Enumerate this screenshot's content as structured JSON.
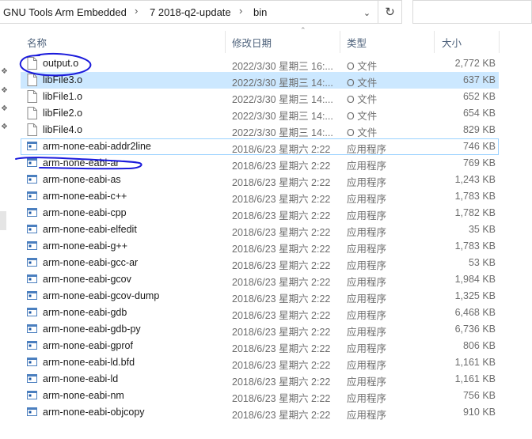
{
  "address": {
    "crumbs": [
      "GNU Tools Arm Embedded",
      "7 2018-q2-update",
      "bin"
    ]
  },
  "columns": {
    "name": "名称",
    "date": "修改日期",
    "type": "类型",
    "size": "大小"
  },
  "files": [
    {
      "name": "output.o",
      "date": "2022/3/30 星期三 16:...",
      "type": "O 文件",
      "size": "2,772 KB",
      "icon": "file-icon"
    },
    {
      "name": "libFile3.o",
      "date": "2022/3/30 星期三 14:...",
      "type": "O 文件",
      "size": "637 KB",
      "icon": "file-icon"
    },
    {
      "name": "libFile1.o",
      "date": "2022/3/30 星期三 14:...",
      "type": "O 文件",
      "size": "652 KB",
      "icon": "file-icon"
    },
    {
      "name": "libFile2.o",
      "date": "2022/3/30 星期三 14:...",
      "type": "O 文件",
      "size": "654 KB",
      "icon": "file-icon"
    },
    {
      "name": "libFile4.o",
      "date": "2022/3/30 星期三 14:...",
      "type": "O 文件",
      "size": "829 KB",
      "icon": "file-icon"
    },
    {
      "name": "arm-none-eabi-addr2line",
      "date": "2018/6/23 星期六 2:22",
      "type": "应用程序",
      "size": "746 KB",
      "icon": "exe-icon"
    },
    {
      "name": "arm-none-eabi-ar",
      "date": "2018/6/23 星期六 2:22",
      "type": "应用程序",
      "size": "769 KB",
      "icon": "exe-icon"
    },
    {
      "name": "arm-none-eabi-as",
      "date": "2018/6/23 星期六 2:22",
      "type": "应用程序",
      "size": "1,243 KB",
      "icon": "exe-icon"
    },
    {
      "name": "arm-none-eabi-c++",
      "date": "2018/6/23 星期六 2:22",
      "type": "应用程序",
      "size": "1,783 KB",
      "icon": "exe-icon"
    },
    {
      "name": "arm-none-eabi-cpp",
      "date": "2018/6/23 星期六 2:22",
      "type": "应用程序",
      "size": "1,782 KB",
      "icon": "exe-icon"
    },
    {
      "name": "arm-none-eabi-elfedit",
      "date": "2018/6/23 星期六 2:22",
      "type": "应用程序",
      "size": "35 KB",
      "icon": "exe-icon"
    },
    {
      "name": "arm-none-eabi-g++",
      "date": "2018/6/23 星期六 2:22",
      "type": "应用程序",
      "size": "1,783 KB",
      "icon": "exe-icon"
    },
    {
      "name": "arm-none-eabi-gcc-ar",
      "date": "2018/6/23 星期六 2:22",
      "type": "应用程序",
      "size": "53 KB",
      "icon": "exe-icon"
    },
    {
      "name": "arm-none-eabi-gcov",
      "date": "2018/6/23 星期六 2:22",
      "type": "应用程序",
      "size": "1,984 KB",
      "icon": "exe-icon"
    },
    {
      "name": "arm-none-eabi-gcov-dump",
      "date": "2018/6/23 星期六 2:22",
      "type": "应用程序",
      "size": "1,325 KB",
      "icon": "exe-icon"
    },
    {
      "name": "arm-none-eabi-gdb",
      "date": "2018/6/23 星期六 2:22",
      "type": "应用程序",
      "size": "6,468 KB",
      "icon": "exe-icon"
    },
    {
      "name": "arm-none-eabi-gdb-py",
      "date": "2018/6/23 星期六 2:22",
      "type": "应用程序",
      "size": "6,736 KB",
      "icon": "exe-icon"
    },
    {
      "name": "arm-none-eabi-gprof",
      "date": "2018/6/23 星期六 2:22",
      "type": "应用程序",
      "size": "806 KB",
      "icon": "exe-icon"
    },
    {
      "name": "arm-none-eabi-ld.bfd",
      "date": "2018/6/23 星期六 2:22",
      "type": "应用程序",
      "size": "1,161 KB",
      "icon": "exe-icon"
    },
    {
      "name": "arm-none-eabi-ld",
      "date": "2018/6/23 星期六 2:22",
      "type": "应用程序",
      "size": "1,161 KB",
      "icon": "exe-icon"
    },
    {
      "name": "arm-none-eabi-nm",
      "date": "2018/6/23 星期六 2:22",
      "type": "应用程序",
      "size": "756 KB",
      "icon": "exe-icon"
    },
    {
      "name": "arm-none-eabi-objcopy",
      "date": "2018/6/23 星期六 2:22",
      "type": "应用程序",
      "size": "910 KB",
      "icon": "exe-icon"
    }
  ],
  "selected_index": 1,
  "focused_index": 5,
  "colors": {
    "selection": "#cce8ff",
    "header_text": "#4c607a",
    "annotation": "#1a1adb"
  }
}
